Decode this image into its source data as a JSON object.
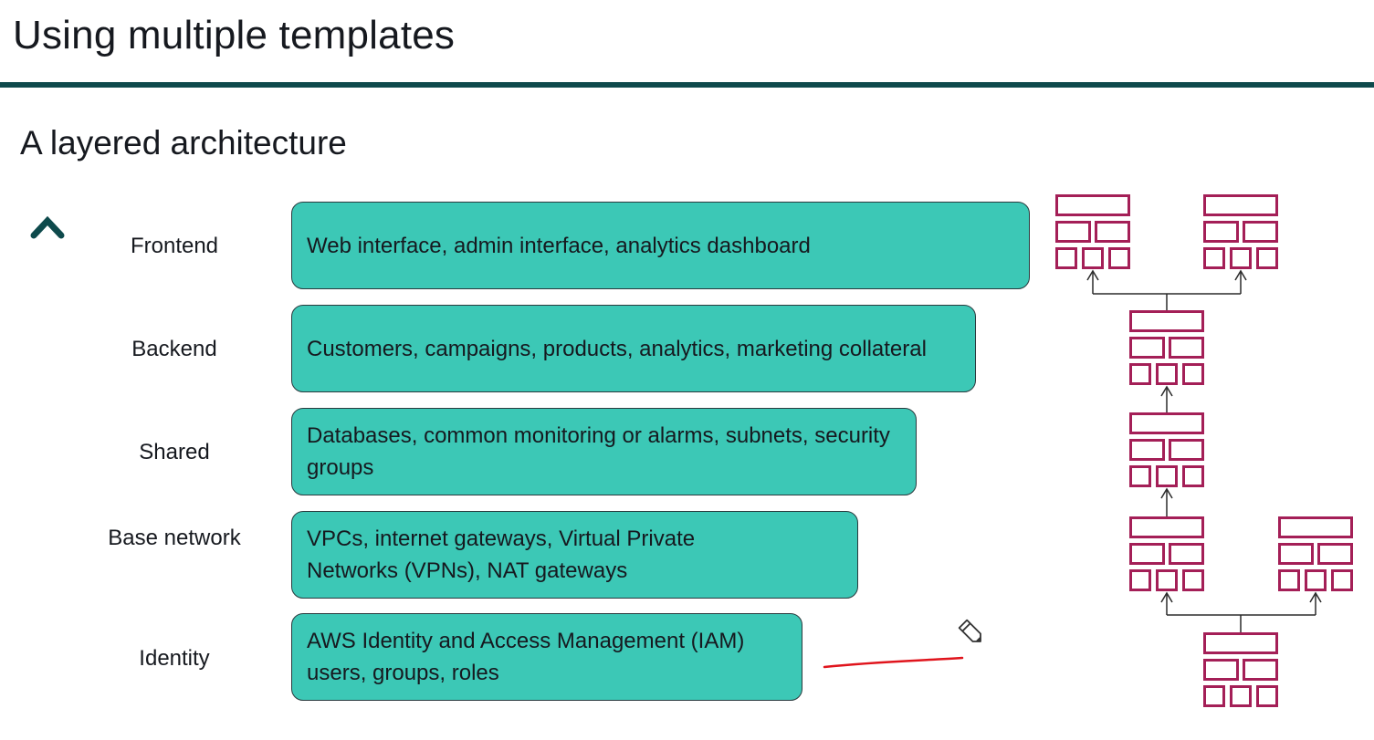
{
  "slide": {
    "title": "Using multiple templates",
    "subtitle": "A layered architecture"
  },
  "layers": [
    {
      "label": "Frontend",
      "description": "Web interface, admin interface, analytics dashboard"
    },
    {
      "label": "Backend",
      "description": "Customers, campaigns, products, analytics, marketing collateral"
    },
    {
      "label": "Shared",
      "description": "Databases, common monitoring or alarms, subnets, security groups"
    },
    {
      "label": "Base network",
      "description": "VPCs, internet gateways, Virtual Private Networks (VPNs), NAT gateways"
    },
    {
      "label": "Identity",
      "description": "AWS Identity and Access Management (IAM) users, groups, roles"
    }
  ],
  "colors": {
    "title_rule": "#0e4a4c",
    "box_fill": "#3cc8b6",
    "template_icon": "#a41f57",
    "arrow_top": "#0e4a4c",
    "arrow_bottom": "#33c4b4",
    "annotation": "#e0141c"
  },
  "icons": {
    "template": "stack-template-icon",
    "pen": "pen-cursor-icon"
  }
}
